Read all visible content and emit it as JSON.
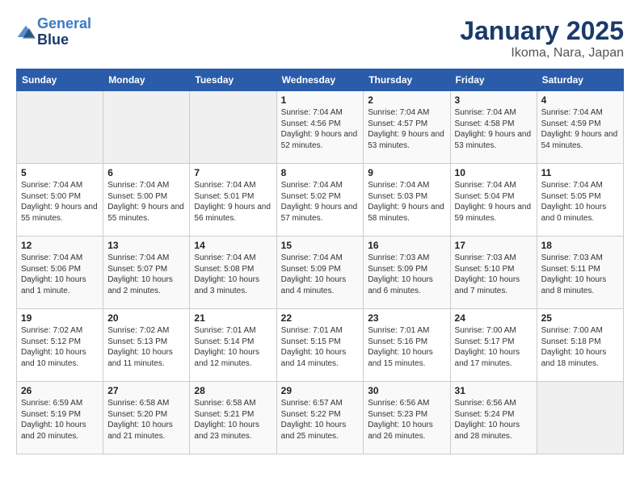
{
  "header": {
    "logo_line1": "General",
    "logo_line2": "Blue",
    "month": "January 2025",
    "location": "Ikoma, Nara, Japan"
  },
  "weekdays": [
    "Sunday",
    "Monday",
    "Tuesday",
    "Wednesday",
    "Thursday",
    "Friday",
    "Saturday"
  ],
  "weeks": [
    [
      {
        "day": "",
        "empty": true
      },
      {
        "day": "",
        "empty": true
      },
      {
        "day": "",
        "empty": true
      },
      {
        "day": "1",
        "sunrise": "7:04 AM",
        "sunset": "4:56 PM",
        "daylight": "9 hours and 52 minutes."
      },
      {
        "day": "2",
        "sunrise": "7:04 AM",
        "sunset": "4:57 PM",
        "daylight": "9 hours and 53 minutes."
      },
      {
        "day": "3",
        "sunrise": "7:04 AM",
        "sunset": "4:58 PM",
        "daylight": "9 hours and 53 minutes."
      },
      {
        "day": "4",
        "sunrise": "7:04 AM",
        "sunset": "4:59 PM",
        "daylight": "9 hours and 54 minutes."
      }
    ],
    [
      {
        "day": "5",
        "sunrise": "7:04 AM",
        "sunset": "5:00 PM",
        "daylight": "9 hours and 55 minutes."
      },
      {
        "day": "6",
        "sunrise": "7:04 AM",
        "sunset": "5:00 PM",
        "daylight": "9 hours and 55 minutes."
      },
      {
        "day": "7",
        "sunrise": "7:04 AM",
        "sunset": "5:01 PM",
        "daylight": "9 hours and 56 minutes."
      },
      {
        "day": "8",
        "sunrise": "7:04 AM",
        "sunset": "5:02 PM",
        "daylight": "9 hours and 57 minutes."
      },
      {
        "day": "9",
        "sunrise": "7:04 AM",
        "sunset": "5:03 PM",
        "daylight": "9 hours and 58 minutes."
      },
      {
        "day": "10",
        "sunrise": "7:04 AM",
        "sunset": "5:04 PM",
        "daylight": "9 hours and 59 minutes."
      },
      {
        "day": "11",
        "sunrise": "7:04 AM",
        "sunset": "5:05 PM",
        "daylight": "10 hours and 0 minutes."
      }
    ],
    [
      {
        "day": "12",
        "sunrise": "7:04 AM",
        "sunset": "5:06 PM",
        "daylight": "10 hours and 1 minute."
      },
      {
        "day": "13",
        "sunrise": "7:04 AM",
        "sunset": "5:07 PM",
        "daylight": "10 hours and 2 minutes."
      },
      {
        "day": "14",
        "sunrise": "7:04 AM",
        "sunset": "5:08 PM",
        "daylight": "10 hours and 3 minutes."
      },
      {
        "day": "15",
        "sunrise": "7:04 AM",
        "sunset": "5:09 PM",
        "daylight": "10 hours and 4 minutes."
      },
      {
        "day": "16",
        "sunrise": "7:03 AM",
        "sunset": "5:09 PM",
        "daylight": "10 hours and 6 minutes."
      },
      {
        "day": "17",
        "sunrise": "7:03 AM",
        "sunset": "5:10 PM",
        "daylight": "10 hours and 7 minutes."
      },
      {
        "day": "18",
        "sunrise": "7:03 AM",
        "sunset": "5:11 PM",
        "daylight": "10 hours and 8 minutes."
      }
    ],
    [
      {
        "day": "19",
        "sunrise": "7:02 AM",
        "sunset": "5:12 PM",
        "daylight": "10 hours and 10 minutes."
      },
      {
        "day": "20",
        "sunrise": "7:02 AM",
        "sunset": "5:13 PM",
        "daylight": "10 hours and 11 minutes."
      },
      {
        "day": "21",
        "sunrise": "7:01 AM",
        "sunset": "5:14 PM",
        "daylight": "10 hours and 12 minutes."
      },
      {
        "day": "22",
        "sunrise": "7:01 AM",
        "sunset": "5:15 PM",
        "daylight": "10 hours and 14 minutes."
      },
      {
        "day": "23",
        "sunrise": "7:01 AM",
        "sunset": "5:16 PM",
        "daylight": "10 hours and 15 minutes."
      },
      {
        "day": "24",
        "sunrise": "7:00 AM",
        "sunset": "5:17 PM",
        "daylight": "10 hours and 17 minutes."
      },
      {
        "day": "25",
        "sunrise": "7:00 AM",
        "sunset": "5:18 PM",
        "daylight": "10 hours and 18 minutes."
      }
    ],
    [
      {
        "day": "26",
        "sunrise": "6:59 AM",
        "sunset": "5:19 PM",
        "daylight": "10 hours and 20 minutes."
      },
      {
        "day": "27",
        "sunrise": "6:58 AM",
        "sunset": "5:20 PM",
        "daylight": "10 hours and 21 minutes."
      },
      {
        "day": "28",
        "sunrise": "6:58 AM",
        "sunset": "5:21 PM",
        "daylight": "10 hours and 23 minutes."
      },
      {
        "day": "29",
        "sunrise": "6:57 AM",
        "sunset": "5:22 PM",
        "daylight": "10 hours and 25 minutes."
      },
      {
        "day": "30",
        "sunrise": "6:56 AM",
        "sunset": "5:23 PM",
        "daylight": "10 hours and 26 minutes."
      },
      {
        "day": "31",
        "sunrise": "6:56 AM",
        "sunset": "5:24 PM",
        "daylight": "10 hours and 28 minutes."
      },
      {
        "day": "",
        "empty": true
      }
    ]
  ]
}
